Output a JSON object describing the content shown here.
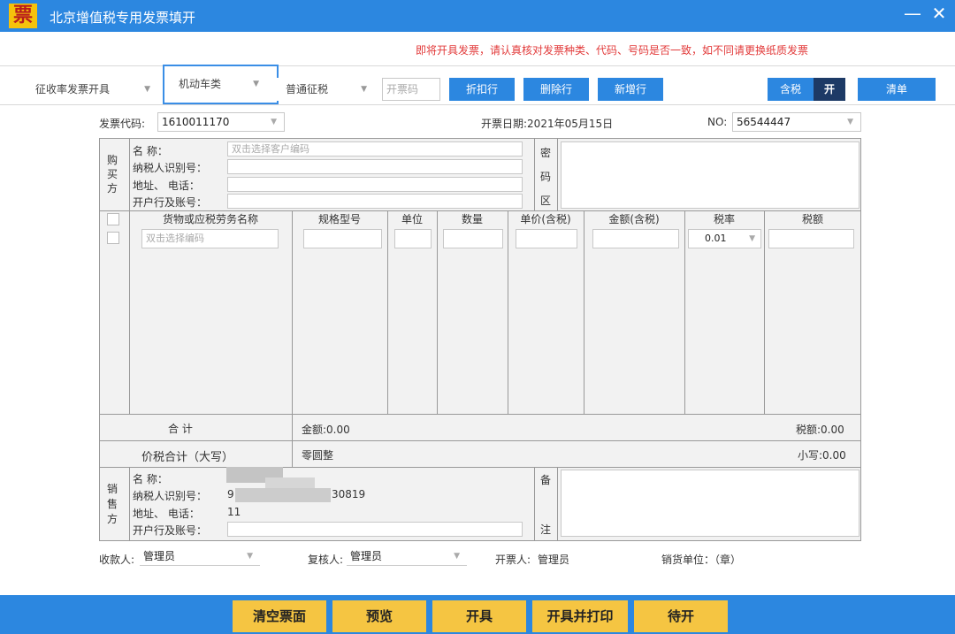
{
  "window": {
    "logo_char": "票",
    "title": "北京增值税专用发票填开",
    "min_glyph": "—",
    "close_glyph": "✕"
  },
  "notice": "即将开具发票，请认真核对发票种类、代码、号码是否一致，如不同请更换纸质发票",
  "toolbar": {
    "invoice_type": "征收率发票开具",
    "vehicle_type": "机动车类",
    "tax_type": "普通征税",
    "invoice_code_placeholder": "开票码",
    "discount_label": "折扣行",
    "delete_label": "删除行",
    "add_label": "新增行",
    "tax_included_label": "含税",
    "tax_included_toggle": "开",
    "list_label": "清单"
  },
  "header": {
    "code_label": "发票代码:",
    "code_value": "1610011170",
    "date_text": "开票日期:2021年05月15日",
    "no_label": "NO:",
    "no_value": "56544447"
  },
  "buyer": {
    "section_label": [
      "购",
      "买",
      "方"
    ],
    "name_label": "名        称：",
    "name_placeholder": "双击选择客户编码",
    "taxid_label": "纳税人识别号：",
    "address_label": "地址、   电话：",
    "bank_label": "开户行及账号："
  },
  "cipher": {
    "label": [
      "密",
      "码",
      "区"
    ]
  },
  "items": {
    "headers": [
      "货物或应税劳务名称",
      "规格型号",
      "单位",
      "数量",
      "单价(含税)",
      "金额(含税)",
      "税率",
      "税额"
    ],
    "name_placeholder": "双击选择编码",
    "tax_rate": "0.01"
  },
  "totals": {
    "total_label": "合      计",
    "amount_text": "金额:0.00",
    "tax_text": "税额:0.00",
    "sum_label": "价税合计（大写）",
    "sum_upper": "零圆整",
    "sum_lower": "小写:0.00"
  },
  "seller": {
    "section_label": [
      "销",
      "售",
      "方"
    ],
    "name_label": "名        称：",
    "taxid_label": "纳税人识别号：",
    "taxid_visible": "9",
    "taxid_tail": "30819",
    "address_label": "地址、   电话：",
    "address_value": "11",
    "bank_label": "开户行及账号："
  },
  "remark": {
    "label": [
      "备",
      "注"
    ]
  },
  "signers": {
    "payee_label": "收款人:",
    "payee_value": "管理员",
    "reviewer_label": "复核人:",
    "reviewer_value": "管理员",
    "issuer_label": "开票人:",
    "issuer_value": "管理员",
    "seller_unit": "销货单位：（章）"
  },
  "actions": {
    "clear": "清空票面",
    "preview": "预览",
    "issue": "开具",
    "issue_print": "开具并打印",
    "pending": "待开"
  },
  "colors": {
    "titlebar": "#2c87e0",
    "notice": "#e23a3a",
    "action_button": "#f5c542"
  }
}
